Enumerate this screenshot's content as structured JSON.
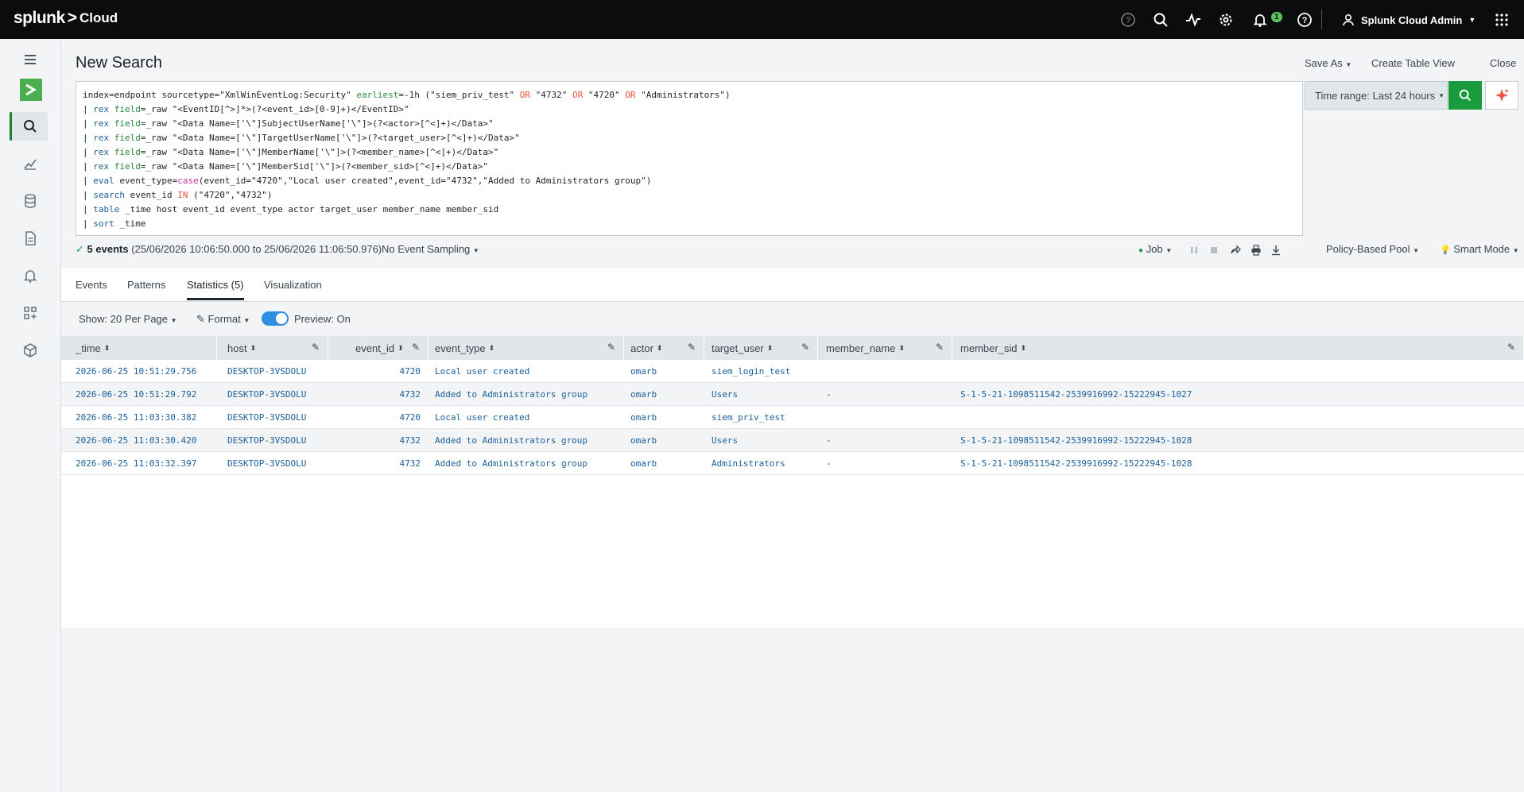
{
  "brand": {
    "name": "splunk",
    "gt": ">",
    "product": "Cloud"
  },
  "topbar": {
    "icons": [
      "help-circle-icon",
      "search-icon",
      "activity-icon",
      "gear-icon",
      "bell-icon",
      "question-icon",
      "user-icon",
      "grid-icon"
    ],
    "notification_count": "1",
    "user": "Splunk Cloud Admin"
  },
  "sidebar": {
    "items": [
      "menu-icon",
      "app-logo",
      "search-icon",
      "chart-icon",
      "database-icon",
      "document-icon",
      "bell-icon",
      "apps-icon",
      "package-icon"
    ]
  },
  "header": {
    "title": "New Search",
    "save_as": "Save As",
    "create_table_view": "Create Table View",
    "close": "Close"
  },
  "query": {
    "lines": [
      "index=endpoint sourcetype=\"XmlWinEventLog:Security\" earliest=-1h (\"siem_priv_test\" OR \"4732\" OR \"4720\" OR \"Administrators\")",
      "| rex field=_raw \"<EventID[^>]*>(?<event_id>[0-9]+)</EventID>\"",
      "| rex field=_raw \"<Data Name=['\\\"]SubjectUserName['\\\"]>(?<actor>[^<]+)</Data>\"",
      "| rex field=_raw \"<Data Name=['\\\"]TargetUserName['\\\"]>(?<target_user>[^<]+)</Data>\"",
      "| rex field=_raw \"<Data Name=['\\\"]MemberName['\\\"]>(?<member_name>[^<]+)</Data>\"",
      "| rex field=_raw \"<Data Name=['\\\"]MemberSid['\\\"]>(?<member_sid>[^<]+)</Data>\"",
      "| eval event_type=case(event_id=\"4720\",\"Local user created\",event_id=\"4732\",\"Added to Administrators group\")",
      "| search event_id IN (\"4720\",\"4732\")",
      "| table _time host event_id event_type actor target_user member_name member_sid",
      "| sort _time"
    ]
  },
  "time_range": {
    "label": "Time range: Last 24 hours"
  },
  "status": {
    "count": "5 events",
    "range": "(25/06/2026 10:06:50.000 to 25/06/2026 11:06:50.976)",
    "sampling": "No Event Sampling",
    "job": "Job",
    "pool": "Policy-Based Pool",
    "mode": "Smart Mode"
  },
  "tabs": [
    "Events",
    "Patterns",
    "Statistics (5)",
    "Visualization"
  ],
  "controls": {
    "per_page": "Show: 20 Per Page",
    "format": "Format",
    "preview": "Preview: On"
  },
  "table": {
    "columns": [
      "_time",
      "host",
      "event_id",
      "event_type",
      "actor",
      "target_user",
      "member_name",
      "member_sid"
    ],
    "rows": [
      [
        "2026-06-25 10:51:29.756",
        "DESKTOP-3VSDOLU",
        "4720",
        "Local user created",
        "omarb",
        "siem_login_test",
        "",
        ""
      ],
      [
        "2026-06-25 10:51:29.792",
        "DESKTOP-3VSDOLU",
        "4732",
        "Added to Administrators group",
        "omarb",
        "Users",
        "-",
        "S-1-5-21-1098511542-2539916992-15222945-1027"
      ],
      [
        "2026-06-25 11:03:30.382",
        "DESKTOP-3VSDOLU",
        "4720",
        "Local user created",
        "omarb",
        "siem_priv_test",
        "",
        ""
      ],
      [
        "2026-06-25 11:03:30.420",
        "DESKTOP-3VSDOLU",
        "4732",
        "Added to Administrators group",
        "omarb",
        "Users",
        "-",
        "S-1-5-21-1098511542-2539916992-15222945-1028"
      ],
      [
        "2026-06-25 11:03:32.397",
        "DESKTOP-3VSDOLU",
        "4732",
        "Added to Administrators group",
        "omarb",
        "Administrators",
        "-",
        "S-1-5-21-1098511542-2539916992-15222945-1028"
      ]
    ]
  }
}
